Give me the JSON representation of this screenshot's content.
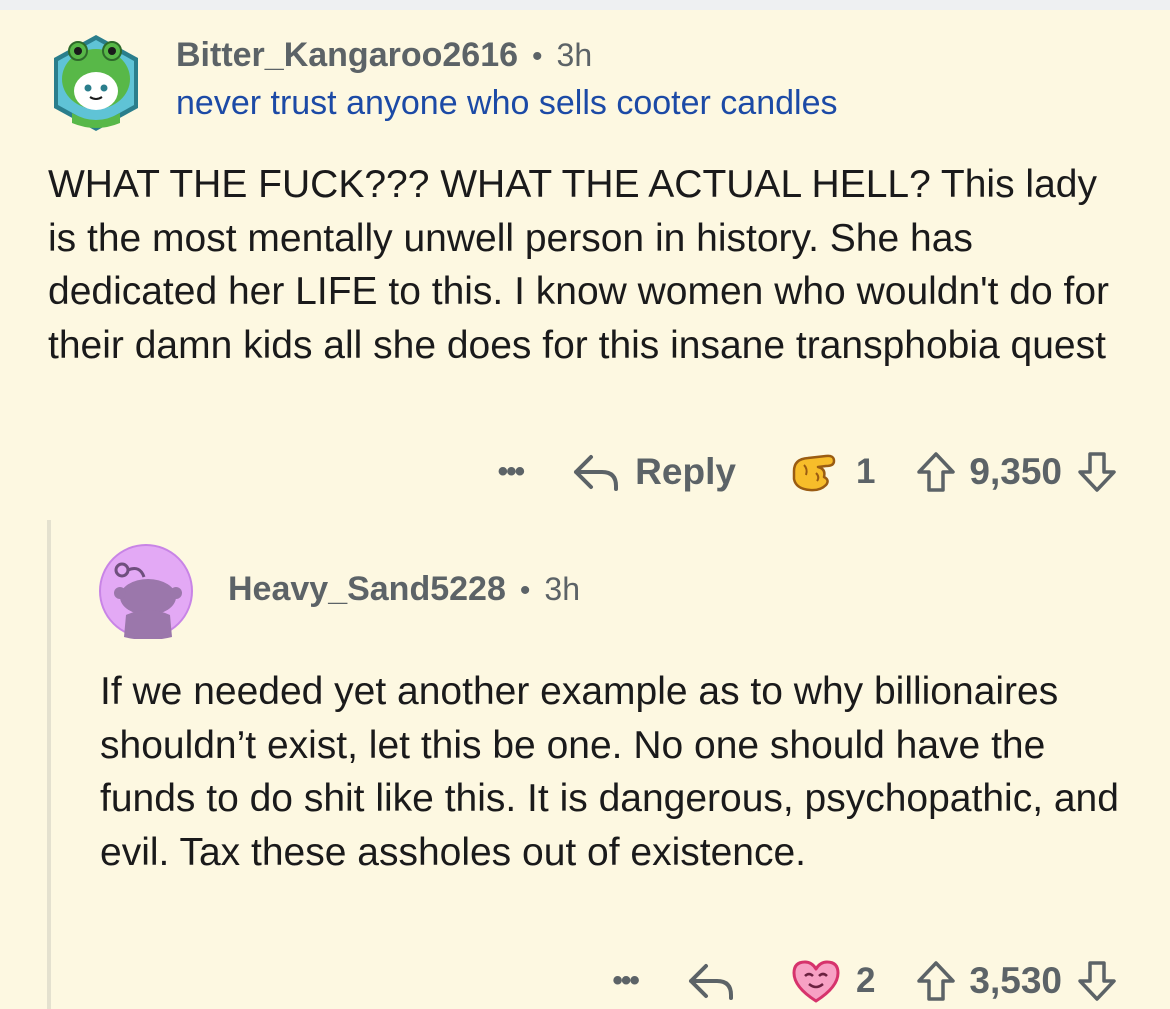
{
  "comment": {
    "author": "Bitter_Kangaroo2616",
    "separator": "•",
    "age": "3h",
    "flair": "never trust anyone who sells cooter candles",
    "body": "WHAT THE FUCK??? WHAT THE ACTUAL HELL? This lady is the most mentally unwell person in history. She has dedicated her LIFE to this. I know women who wouldn't do for their damn kids all she does for this insane transphobia quest",
    "actions": {
      "more_icon": "more-dots-icon",
      "more": "•••",
      "reply_icon": "reply-arrow-icon",
      "reply_label": "Reply",
      "award_icon": "pointing-hand-award-icon",
      "award_count": "1",
      "upvote_icon": "upvote-arrow-icon",
      "score": "9,350",
      "downvote_icon": "downvote-arrow-icon"
    }
  },
  "reply": {
    "author": "Heavy_Sand5228",
    "separator": "•",
    "age": "3h",
    "body": "If we needed yet another example as to why billionaires shouldn’t exist, let this be one. No one should have the funds to do shit like this. It is dangerous, psychopathic, and evil. Tax these assholes out of existence.",
    "actions": {
      "more_icon": "more-dots-icon",
      "more": "•••",
      "reply_icon": "reply-arrow-icon",
      "award_icon": "heart-face-award-icon",
      "award_count": "2",
      "upvote_icon": "upvote-arrow-icon",
      "score": "3,530",
      "downvote_icon": "downvote-arrow-icon"
    }
  },
  "colors": {
    "background": "#fdf8e1",
    "meta_text": "#5c6367",
    "flair_text": "#1c4aa6",
    "body_text": "#1a1a1b",
    "thread_line": "#e4e1cf",
    "avatar_reply_bg": "#e3a9f5"
  }
}
